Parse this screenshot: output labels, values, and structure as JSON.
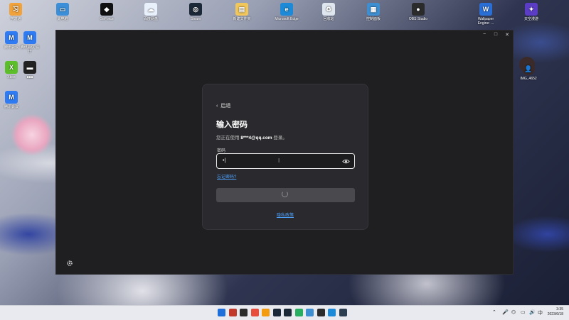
{
  "desktop": {
    "icons_top": [
      {
        "label": "学习通",
        "color": "#f2a23a",
        "glyph": "习"
      },
      {
        "label": "此电脑",
        "color": "#3a8fd8",
        "glyph": "▭"
      },
      {
        "label": "GeForce",
        "color": "#111111",
        "glyph": "◆"
      },
      {
        "label": "百度网盘",
        "color": "#e8f0fb",
        "glyph": "☁"
      },
      {
        "label": "Steam",
        "color": "#1b2838",
        "glyph": "◎"
      },
      {
        "label": "新建文件夹",
        "color": "#f1c75b",
        "glyph": "▤"
      },
      {
        "label": "Microsoft Edge",
        "color": "#1c8ad6",
        "glyph": "e"
      },
      {
        "label": "回收站",
        "color": "#dfe6ee",
        "glyph": "♻"
      },
      {
        "label": "控制面板",
        "color": "#3d8fd1",
        "glyph": "▦"
      },
      {
        "label": "OBS Studio",
        "color": "#2b2b2b",
        "glyph": "●"
      },
      {
        "label": "Wallpaper Engine: ...",
        "color": "#2a6fd6",
        "glyph": "W"
      },
      {
        "label": "天空漫游",
        "color": "#5b3cc4",
        "glyph": "✦"
      }
    ],
    "icons_left": [
      {
        "label": "腾讯会议",
        "color": "#2e7bf3",
        "glyph": "M"
      },
      {
        "label": "腾讯会议 设计",
        "color": "#2e7bf3",
        "glyph": "M"
      },
      {
        "label": "Xbox",
        "color": "#5cbf2a",
        "glyph": "X"
      },
      {
        "label": "■■■",
        "color": "#222222",
        "glyph": "▬"
      },
      {
        "label": "腾讯会议",
        "color": "#2e7bf3",
        "glyph": "M"
      }
    ],
    "icon_right_label": "IMG_4652"
  },
  "window": {
    "controls": [
      "−",
      "□",
      "✕"
    ]
  },
  "login": {
    "back_label": "后退",
    "title": "输入密码",
    "subtitle_prefix": "您正在使用",
    "account": "8***4@qq.com",
    "subtitle_suffix": "登录。",
    "password_label": "密码",
    "password_value": "•|",
    "forgot_link": "忘记密码?",
    "privacy_link": "隐私政策",
    "submit_state": "loading"
  },
  "taskbar": {
    "time": "3:35",
    "date": "2023/6/18",
    "apps": [
      "start",
      "search",
      "task",
      "edge",
      "explorer",
      "store",
      "steam",
      "files",
      "obs",
      "wallpaper",
      "onenote",
      "app"
    ]
  },
  "colors": {
    "link": "#4fa3ff",
    "window_bg": "#1f1f22",
    "card_bg": "#2a2a2e"
  }
}
